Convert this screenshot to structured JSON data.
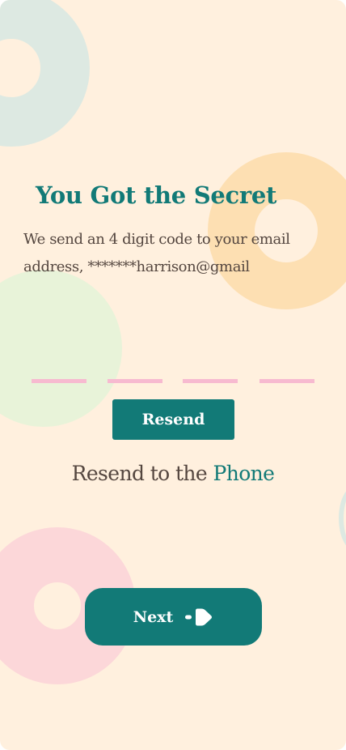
{
  "header": {
    "title": "You Got the Secret",
    "subtitle": "We send an 4 digit code to your email address, *******harrison@gmail"
  },
  "otp": {
    "digits": [
      "",
      "",
      "",
      ""
    ],
    "underline_color": "#f7bad0"
  },
  "actions": {
    "resend_label": "Resend",
    "resend_to_prefix": "Resend to the",
    "resend_to_link": "Phone",
    "next_label": "Next",
    "next_icon": "arrow-right-icon"
  },
  "colors": {
    "background": "#fff0de",
    "primary": "#127a77",
    "text": "#54463f",
    "decor_teal": "#dde9e2",
    "decor_orange": "#fddfb2",
    "decor_green": "#e8f3d9",
    "decor_pink": "#fcd7d9"
  }
}
